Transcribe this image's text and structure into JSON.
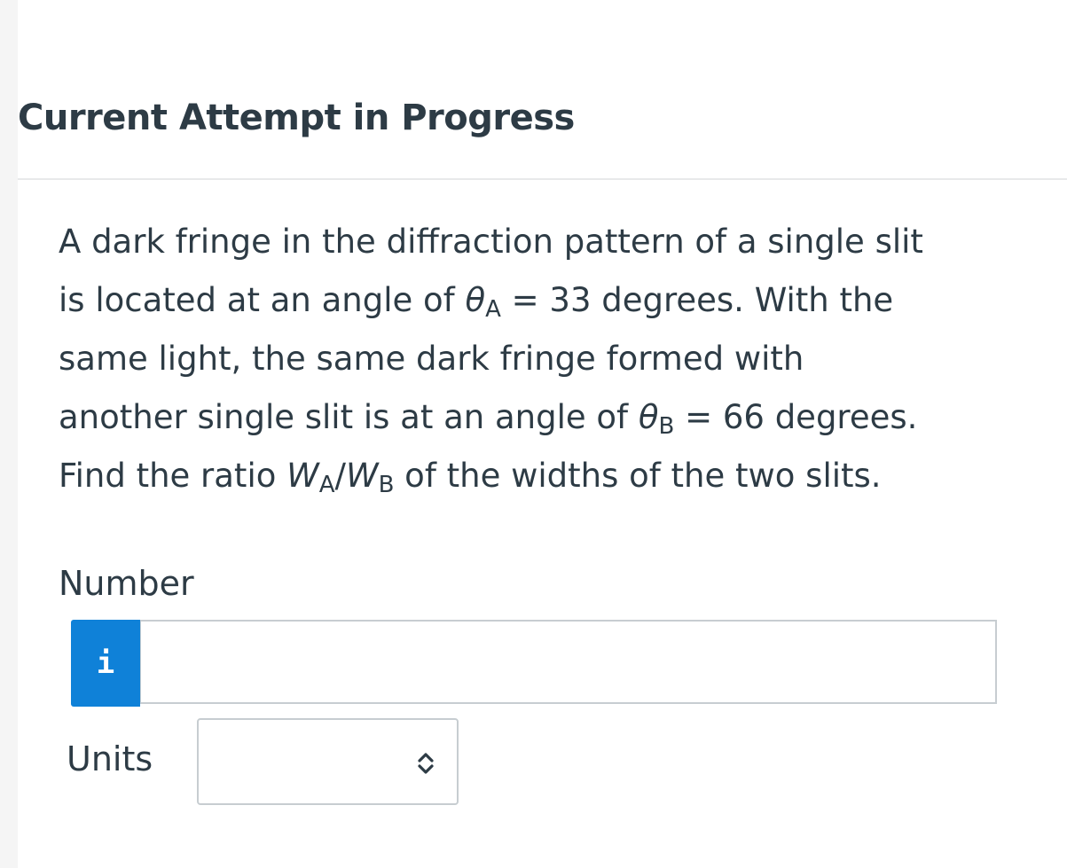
{
  "header": {
    "title": "Current Attempt in Progress"
  },
  "question": {
    "line1": "A dark fringe in the diffraction pattern of a single slit",
    "line2_a": "is located at an angle of ",
    "theta_symbol": "θ",
    "sub_a": "A",
    "line2_b": " = 33 degrees. With the",
    "line3": "same light, the same dark fringe formed with",
    "line4_a": "another single slit is at an angle of ",
    "sub_b": "B",
    "line4_b": " = 66 degrees.",
    "line5_a": "Find the ratio ",
    "w_symbol": "W",
    "slash": "/",
    "line5_b": " of the widths of the two slits."
  },
  "answer": {
    "number_label": "Number",
    "info_icon_glyph": "i",
    "number_value": "",
    "units_label": "Units",
    "units_selected": ""
  },
  "colors": {
    "accent": "#0f81d8",
    "text": "#2d3b45",
    "border": "#c7cdd1"
  }
}
